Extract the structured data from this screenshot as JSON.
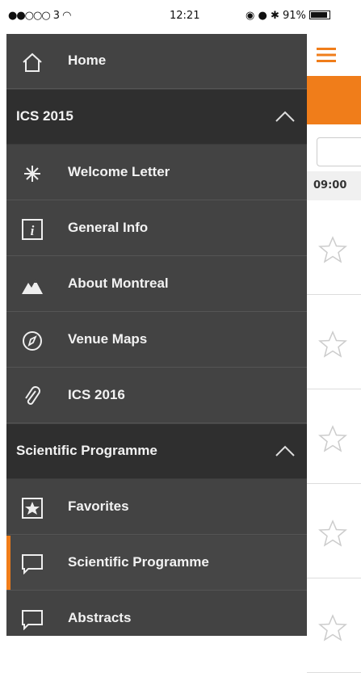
{
  "status": {
    "signal": "●●○○○",
    "carrier": "3",
    "time": "12:21",
    "battery": "91%"
  },
  "drawer": {
    "items": [
      {
        "label": "Home",
        "icon": "home-icon"
      },
      {
        "label": "ICS 2015",
        "section": true
      },
      {
        "label": "Welcome Letter",
        "icon": "asterisk-icon"
      },
      {
        "label": "General Info",
        "icon": "info-icon"
      },
      {
        "label": "About Montreal",
        "icon": "mountains-icon"
      },
      {
        "label": "Venue Maps",
        "icon": "compass-icon"
      },
      {
        "label": "ICS 2016",
        "icon": "paperclip-icon"
      },
      {
        "label": "Scientific Programme",
        "section": true
      },
      {
        "label": "Favorites",
        "icon": "star-box-icon"
      },
      {
        "label": "Scientific Programme",
        "icon": "speech-bubble-icon",
        "active": true
      },
      {
        "label": "Abstracts",
        "icon": "speech-bubble-icon"
      }
    ]
  },
  "content": {
    "time_label": "09:00"
  },
  "colors": {
    "accent": "#f07d1a",
    "drawer_bg": "#434343",
    "section_bg": "#2f2f2f"
  }
}
